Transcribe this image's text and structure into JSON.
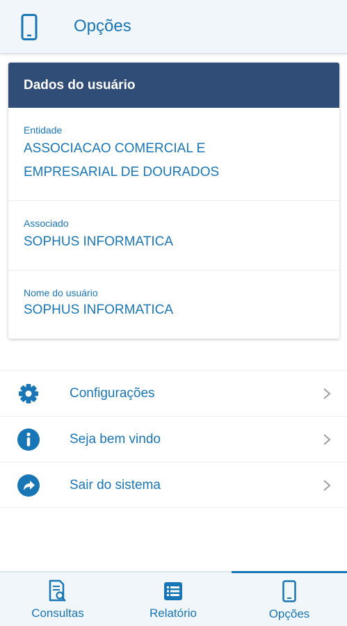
{
  "header": {
    "title": "Opções",
    "icon": "smartphone-icon"
  },
  "card": {
    "title": "Dados do usuário",
    "fields": [
      {
        "label": "Entidade",
        "value_line1": "ASSOCIACAO COMERCIAL E",
        "value_line2": "EMPRESARIAL DE DOURADOS"
      },
      {
        "label": "Associado",
        "value": "SOPHUS INFORMATICA"
      },
      {
        "label": "Nome do usuário",
        "value": "SOPHUS INFORMATICA"
      }
    ]
  },
  "menu": {
    "items": [
      {
        "label": "Configurações",
        "icon": "gear-icon"
      },
      {
        "label": "Seja bem vindo",
        "icon": "info-icon"
      },
      {
        "label": "Sair do sistema",
        "icon": "share-arrow-icon"
      }
    ]
  },
  "bottom_nav": {
    "tabs": [
      {
        "label": "Consultas",
        "icon": "document-search-icon",
        "active": false
      },
      {
        "label": "Relatório",
        "icon": "list-icon",
        "active": false
      },
      {
        "label": "Opções",
        "icon": "smartphone-icon",
        "active": true
      }
    ]
  },
  "colors": {
    "accent": "#1976b6",
    "card_header": "#2f4d77",
    "bar_bg": "#f0f6f9"
  }
}
